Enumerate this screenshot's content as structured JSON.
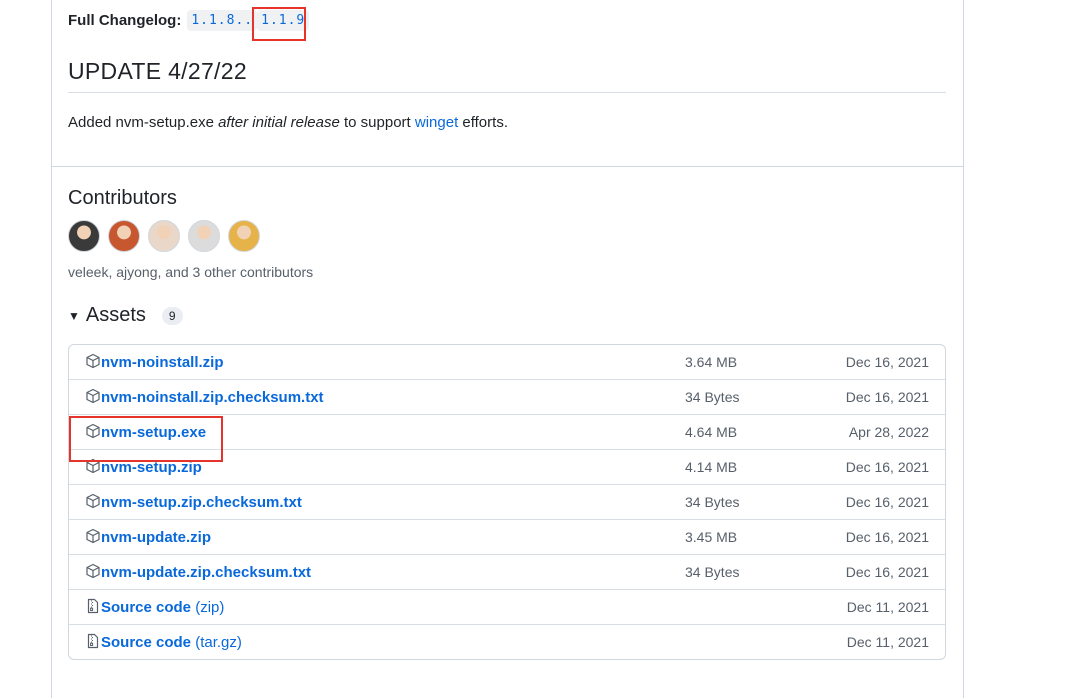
{
  "changelog": {
    "label": "Full Changelog:",
    "from": "1.1.8..",
    "to": "1.1.9"
  },
  "update": {
    "title": "UPDATE 4/27/22",
    "text_before": "Added nvm-setup.exe ",
    "text_italic": "after initial release",
    "text_mid": " to support ",
    "link": "winget",
    "text_after": " efforts."
  },
  "contributors": {
    "title": "Contributors",
    "summary": "veleek, ajyong, and 3 other contributors",
    "avatar_colors": [
      "#3a3a3a",
      "#c7572f",
      "#e9d7c9",
      "#dcdcdc",
      "#e6b34a"
    ]
  },
  "assets": {
    "title": "Assets",
    "count": "9",
    "items": [
      {
        "icon": "package-icon",
        "name": "nvm-noinstall.zip",
        "sub": "",
        "size": "3.64 MB",
        "date": "Dec 16, 2021"
      },
      {
        "icon": "package-icon",
        "name": "nvm-noinstall.zip.checksum.txt",
        "sub": "",
        "size": "34 Bytes",
        "date": "Dec 16, 2021"
      },
      {
        "icon": "package-icon",
        "name": "nvm-setup.exe",
        "sub": "",
        "size": "4.64 MB",
        "date": "Apr 28, 2022"
      },
      {
        "icon": "package-icon",
        "name": "nvm-setup.zip",
        "sub": "",
        "size": "4.14 MB",
        "date": "Dec 16, 2021"
      },
      {
        "icon": "package-icon",
        "name": "nvm-setup.zip.checksum.txt",
        "sub": "",
        "size": "34 Bytes",
        "date": "Dec 16, 2021"
      },
      {
        "icon": "package-icon",
        "name": "nvm-update.zip",
        "sub": "",
        "size": "3.45 MB",
        "date": "Dec 16, 2021"
      },
      {
        "icon": "package-icon",
        "name": "nvm-update.zip.checksum.txt",
        "sub": "",
        "size": "34 Bytes",
        "date": "Dec 16, 2021"
      },
      {
        "icon": "file-zip-icon",
        "name": "Source code",
        "sub": " (zip)",
        "size": "",
        "date": "Dec 11, 2021"
      },
      {
        "icon": "file-zip-icon",
        "name": "Source code",
        "sub": " (tar.gz)",
        "size": "",
        "date": "Dec 11, 2021"
      }
    ]
  },
  "colors": {
    "link": "#0969da",
    "highlight": "#e5342c",
    "border": "#d0d7de"
  }
}
